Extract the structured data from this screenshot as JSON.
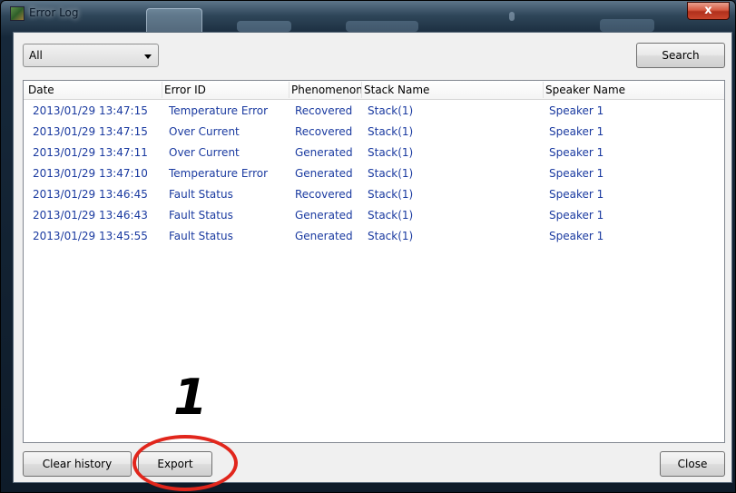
{
  "window": {
    "title": "Error Log",
    "close_glyph": "x"
  },
  "filter": {
    "selected": "All"
  },
  "toolbar": {
    "search_label": "Search"
  },
  "table": {
    "columns": [
      "Date",
      "Error ID",
      "Phenomenon",
      "Stack Name",
      "Speaker Name"
    ],
    "rows": [
      [
        "2013/01/29 13:47:15",
        "Temperature Error",
        "Recovered",
        "Stack(1)",
        "Speaker 1"
      ],
      [
        "2013/01/29 13:47:15",
        "Over Current",
        "Recovered",
        "Stack(1)",
        "Speaker 1"
      ],
      [
        "2013/01/29 13:47:11",
        "Over Current",
        "Generated",
        "Stack(1)",
        "Speaker 1"
      ],
      [
        "2013/01/29 13:47:10",
        "Temperature Error",
        "Generated",
        "Stack(1)",
        "Speaker 1"
      ],
      [
        "2013/01/29 13:46:45",
        "Fault Status",
        "Recovered",
        "Stack(1)",
        "Speaker 1"
      ],
      [
        "2013/01/29 13:46:43",
        "Fault Status",
        "Generated",
        "Stack(1)",
        "Speaker 1"
      ],
      [
        "2013/01/29 13:45:55",
        "Fault Status",
        "Generated",
        "Stack(1)",
        "Speaker 1"
      ]
    ]
  },
  "footer": {
    "clear_label": "Clear history",
    "export_label": "Export",
    "close_label": "Close"
  },
  "annotation": {
    "step_number": "1"
  },
  "colors": {
    "row_text": "#1a3aa0",
    "annotation_ring": "#e1261c"
  }
}
